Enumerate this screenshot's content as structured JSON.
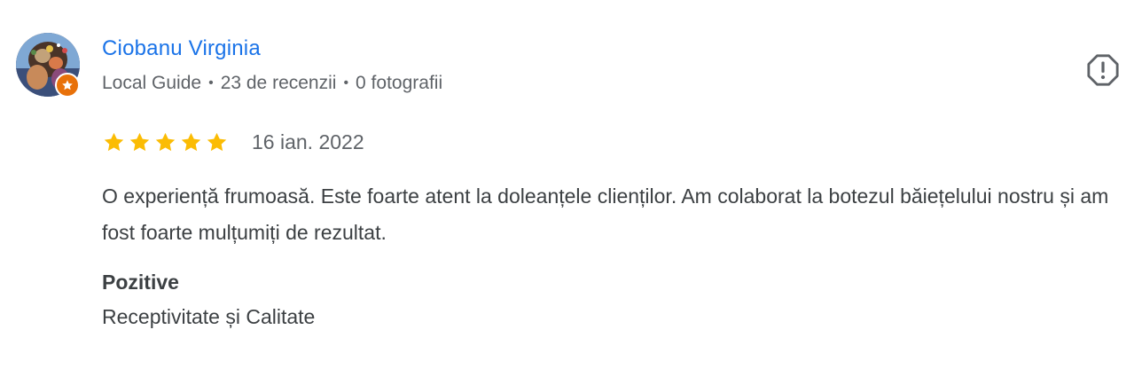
{
  "review": {
    "author_name": "Ciobanu Virginia",
    "author_level": "Local Guide",
    "reviews_count": "23 de recenzii",
    "photos_count": "0 fotografii",
    "meta_separator": "•",
    "rating": 5,
    "rating_max": 5,
    "date": "16 ian. 2022",
    "text": "O experiență frumoasă. Este foarte atent la doleanțele clienților. Am colaborat la botezul băiețelului nostru și am fost foarte mulțumiți de rezultat.",
    "positives_title": "Pozitive",
    "positives_value": "Receptivitate și Calitate"
  },
  "colors": {
    "author_link": "#1a73e8",
    "star": "#fbbc04",
    "badge": "#e8710a",
    "secondary_text": "#5f6368",
    "body_text": "#3c4043"
  },
  "icons": {
    "avatar": "user-photo",
    "badge": "local-guide-star-icon",
    "report": "report-flag-icon",
    "rating": "star-icon"
  }
}
